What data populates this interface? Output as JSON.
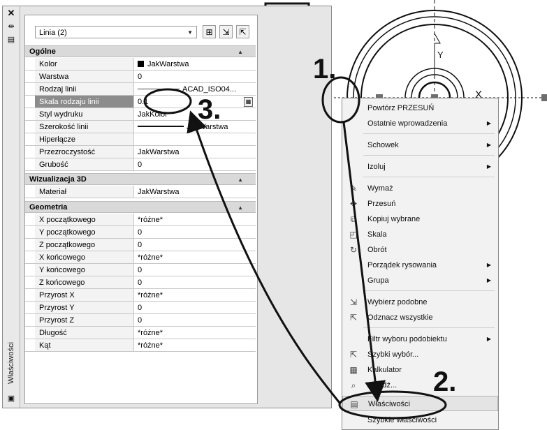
{
  "palette": {
    "side_title": "Właściwości",
    "selection_combo": "Linia (2)",
    "side_icons": [
      "close-icon",
      "auto-hide-icon",
      "properties-icon"
    ],
    "sections": {
      "general": {
        "title": "Ogólne",
        "rows": [
          {
            "label": "Kolor",
            "value": "JakWarstwa"
          },
          {
            "label": "Warstwa",
            "value": "0"
          },
          {
            "label": "Rodzaj linii",
            "value": "ACAD_ISO04..."
          },
          {
            "label": "Skala rodzaju linii",
            "value": "0.1"
          },
          {
            "label": "Styl wydruku",
            "value": "JakKolor"
          },
          {
            "label": "Szerokość linii",
            "value": "JakWarstwa"
          },
          {
            "label": "Hiperłącze",
            "value": ""
          },
          {
            "label": "Przezroczystość",
            "value": "JakWarstwa"
          },
          {
            "label": "Grubość",
            "value": "0"
          }
        ]
      },
      "viz3d": {
        "title": "Wizualizacja 3D",
        "rows": [
          {
            "label": "Materiał",
            "value": "JakWarstwa"
          }
        ]
      },
      "geometry": {
        "title": "Geometria",
        "rows": [
          {
            "label": "X początkowego",
            "value": "*różne*"
          },
          {
            "label": "Y początkowego",
            "value": "0"
          },
          {
            "label": "Z początkowego",
            "value": "0"
          },
          {
            "label": "X końcowego",
            "value": "*różne*"
          },
          {
            "label": "Y końcowego",
            "value": "0"
          },
          {
            "label": "Z końcowego",
            "value": "0"
          },
          {
            "label": "Przyrost X",
            "value": "*różne*"
          },
          {
            "label": "Przyrost Y",
            "value": "0"
          },
          {
            "label": "Przyrost Z",
            "value": "0"
          },
          {
            "label": "Długość",
            "value": "*różne*"
          },
          {
            "label": "Kąt",
            "value": "*różne*"
          }
        ]
      }
    }
  },
  "menu": {
    "items": [
      {
        "label": "Powtórz PRZESUŃ",
        "icon": "",
        "submenu": false
      },
      {
        "label": "Ostatnie wprowadzenia",
        "icon": "",
        "submenu": true
      },
      {
        "label": "Schowek",
        "icon": "",
        "submenu": true
      },
      {
        "label": "Izoluj",
        "icon": "",
        "submenu": true
      },
      {
        "label": "Wymaż",
        "icon": "erase-icon",
        "submenu": false
      },
      {
        "label": "Przesuń",
        "icon": "move-icon",
        "submenu": false
      },
      {
        "label": "Kopiuj wybrane",
        "icon": "copy-icon",
        "submenu": false
      },
      {
        "label": "Skala",
        "icon": "scale-icon",
        "submenu": false
      },
      {
        "label": "Obrót",
        "icon": "rotate-icon",
        "submenu": false
      },
      {
        "label": "Porządek rysowania",
        "icon": "",
        "submenu": true
      },
      {
        "label": "Grupa",
        "icon": "",
        "submenu": true
      },
      {
        "label": "Wybierz podobne",
        "icon": "select-similar-icon",
        "submenu": false
      },
      {
        "label": "Odznacz wszystkie",
        "icon": "deselect-all-icon",
        "submenu": false
      },
      {
        "label": "Filtr wyboru podobiektu",
        "icon": "",
        "submenu": true
      },
      {
        "label": "Szybki wybór...",
        "icon": "quick-select-icon",
        "submenu": false
      },
      {
        "label": "Kalkulator",
        "icon": "calculator-icon",
        "submenu": false
      },
      {
        "label": "Znajdź...",
        "icon": "find-icon",
        "submenu": false
      },
      {
        "label": "Właściwości",
        "icon": "properties-icon",
        "submenu": false
      },
      {
        "label": "Szybkie właściwości",
        "icon": "",
        "submenu": false
      }
    ]
  },
  "annotations": {
    "step1": "1.",
    "step2": "2.",
    "step3": "3."
  },
  "drawing": {
    "axis_y_label": "Y",
    "axis_x_label": "X"
  },
  "colors": {
    "highlight_row": "#8c8c8c",
    "palette_bg": "#e6e6e6"
  }
}
